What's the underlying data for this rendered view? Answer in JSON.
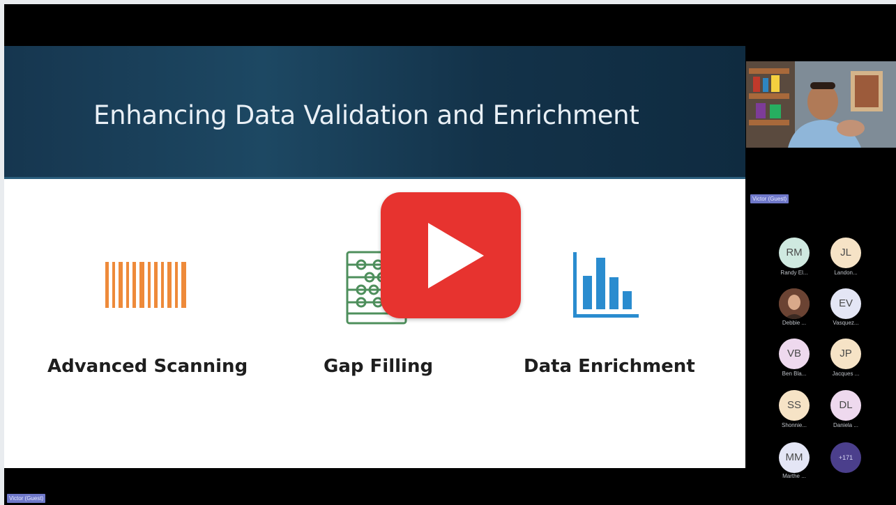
{
  "slide": {
    "title": "Enhancing Data Validation and Enrichment",
    "features": [
      {
        "label": "Advanced Scanning",
        "icon": "barcode-icon",
        "color": "#ee8a3a"
      },
      {
        "label": "Gap Filling",
        "icon": "abacus-icon",
        "color": "#4e8f5c"
      },
      {
        "label": "Data Enrichment",
        "icon": "bar-chart-icon",
        "color": "#2a8ccf"
      }
    ]
  },
  "player": {
    "play_icon": "play-icon",
    "color": "#e7332f"
  },
  "presenter": {
    "name_tag": "Victor (Guest)"
  },
  "self_tag": "Victor (Guest)",
  "participants": [
    {
      "initials": "RM",
      "name": "Randy El...",
      "bg": "#cfe9e0"
    },
    {
      "initials": "JL",
      "name": "Landon...",
      "bg": "#f6e3c6"
    },
    {
      "initials": "",
      "name": "Debbie ...",
      "bg": "#8a5a44",
      "photo": true
    },
    {
      "initials": "EV",
      "name": "Vasquez...",
      "bg": "#e4e6f5"
    },
    {
      "initials": "VB",
      "name": "Ben Bla...",
      "bg": "#eed9ee"
    },
    {
      "initials": "JP",
      "name": "Jacques ...",
      "bg": "#f6e3c6"
    },
    {
      "initials": "SS",
      "name": "Shonnie...",
      "bg": "#f6e3c6"
    },
    {
      "initials": "DL",
      "name": "Daniela ...",
      "bg": "#eed9ee"
    },
    {
      "initials": "MM",
      "name": "Marthe ...",
      "bg": "#e4e6f5"
    }
  ],
  "more_participants": "+171"
}
